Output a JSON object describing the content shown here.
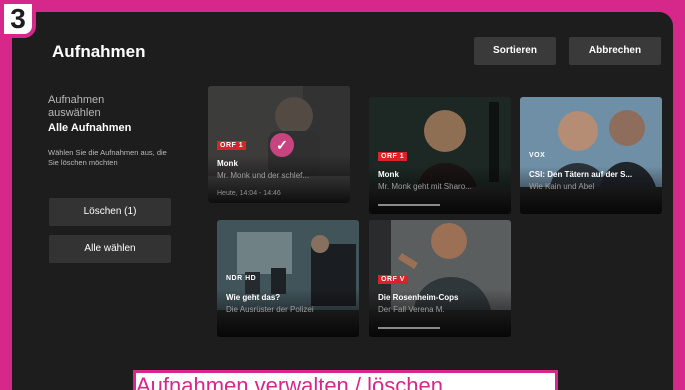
{
  "step": "3",
  "header": {
    "title": "Aufnahmen",
    "sort_label": "Sortieren",
    "cancel_label": "Abbrechen"
  },
  "sidebar": {
    "line1": "Aufnahmen",
    "line2": "auswählen",
    "selected_label": "Alle Aufnahmen",
    "hint": "Wählen Sie die Aufnahmen aus, die Sie löschen möchten",
    "delete_label": "Löschen (1)",
    "select_all_label": "Alle wählen"
  },
  "recordings": [
    {
      "channel": "ORF 1",
      "title": "Monk",
      "subtitle": "Mr. Monk und der schlef...",
      "time": "Heute, 14:04 - 14:46",
      "selected": true
    },
    {
      "channel": "ORF 1",
      "title": "Monk",
      "subtitle": "Mr. Monk geht mit Sharo...",
      "time": "",
      "selected": false
    },
    {
      "channel": "VOX",
      "title": "CSI: Den Tätern auf der S...",
      "subtitle": "Wie Kain und Abel",
      "time": "",
      "selected": false
    },
    {
      "channel": "NDR HD",
      "title": "Wie geht das?",
      "subtitle": "Die Ausrüster der Polizei",
      "time": "",
      "selected": false
    },
    {
      "channel": "ORF V",
      "title": "Die Rosenheim-Cops",
      "subtitle": "Der Fall Verena M.",
      "time": "",
      "selected": false
    }
  ],
  "caption": "Aufnahmen verwalten / löschen",
  "colors": {
    "accent": "#d6288a",
    "background": "#1d1d1d"
  }
}
